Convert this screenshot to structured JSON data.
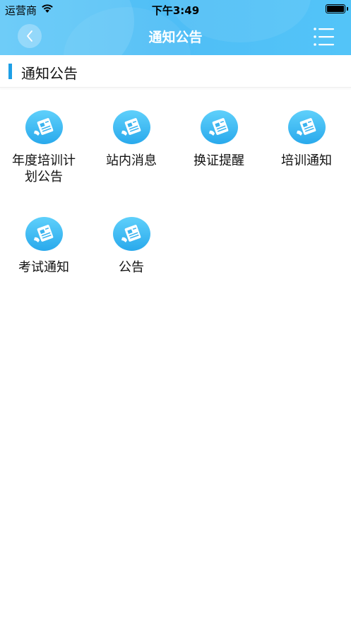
{
  "status_bar": {
    "carrier": "运营商",
    "time": "下午3:49"
  },
  "nav_bar": {
    "title": "通知公告"
  },
  "section": {
    "title": "通知公告"
  },
  "tiles": [
    {
      "label": "年度培训计划公告",
      "icon": "notice-document-icon"
    },
    {
      "label": "站内消息",
      "icon": "notice-document-icon"
    },
    {
      "label": "换证提醒",
      "icon": "notice-document-icon"
    },
    {
      "label": "培训通知",
      "icon": "notice-document-icon"
    },
    {
      "label": "考试通知",
      "icon": "notice-document-icon"
    },
    {
      "label": "公告",
      "icon": "notice-document-icon"
    }
  ],
  "colors": {
    "header": "#4fbef6",
    "accent_bar": "#1e9fe6",
    "icon_top": "#5fd0fb",
    "icon_bottom": "#29a9ec"
  }
}
